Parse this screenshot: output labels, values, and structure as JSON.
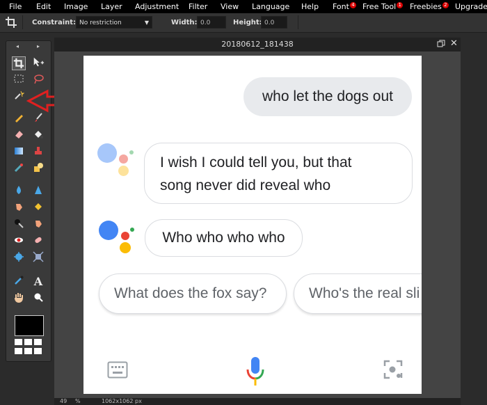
{
  "menu": {
    "items": [
      {
        "label": "File"
      },
      {
        "label": "Edit"
      },
      {
        "label": "Image"
      },
      {
        "label": "Layer"
      },
      {
        "label": "Adjustment"
      },
      {
        "label": "Filter"
      },
      {
        "label": "View"
      },
      {
        "label": "Language"
      },
      {
        "label": "Help"
      },
      {
        "label": "Font",
        "badge": "4"
      },
      {
        "label": "Free Tool",
        "badge": "1"
      },
      {
        "label": "Freebies",
        "badge": "2"
      },
      {
        "label": "Upgrade"
      }
    ]
  },
  "options": {
    "constraint_label": "Constraint:",
    "constraint_value": "No restriction",
    "width_label": "Width:",
    "width_value": "0.0",
    "height_label": "Height:",
    "height_value": "0.0"
  },
  "document": {
    "title": "20180612_181438",
    "zoom": "49",
    "zoom_unit": "%",
    "dimensions": "1062x1062 px"
  },
  "assistant": {
    "user_query": "who let the dogs out",
    "reply1_line1": "I wish I could tell you, but that",
    "reply1_line2": "song never did reveal who",
    "reply2": "Who who who who",
    "suggestion1": "What does the fox say?",
    "suggestion2": "Who's the real sli"
  },
  "colors": {
    "menubar_bg": "#000000",
    "workspace_bg": "#2b2b2b",
    "annotation_arrow": "#e02020",
    "google_blue": "#4285f4",
    "google_red": "#ea4335",
    "google_yellow": "#fbbc05",
    "google_green": "#34a853"
  },
  "icons": {
    "crop_tool": "crop-icon",
    "move_tool": "move-icon",
    "magic_wand": "magic-wand-icon",
    "keyboard": "keyboard-icon",
    "mic": "microphone-icon",
    "lens": "lens-icon"
  }
}
